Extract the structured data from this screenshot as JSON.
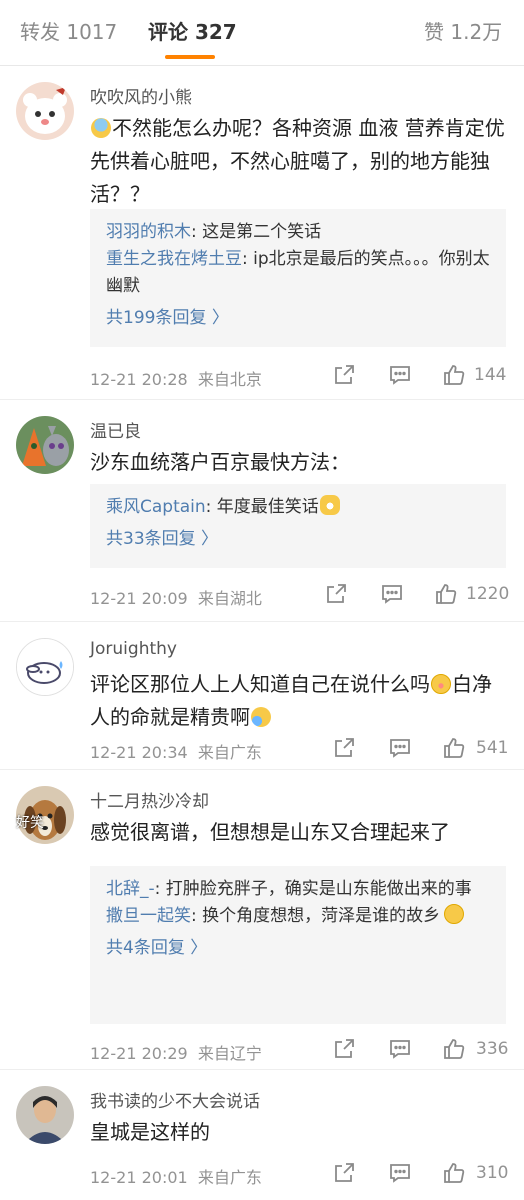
{
  "tabs": {
    "repost": "转发 1017",
    "comments": "评论 327",
    "likes": "赞 1.2万"
  },
  "comments": [
    {
      "author": "吹吹风的小熊",
      "text": "不然能怎么办呢？各种资源 血液 营养肯定优先供着心脏吧，不然心脏噶了，别的地方能独活？？",
      "emoji": "fear-emoji",
      "replies": [
        {
          "user": "羽羽的积木",
          "text": ": 这是第二个笑话"
        },
        {
          "user": "重生之我在烤土豆",
          "text": ": ip北京是最后的笑点。。。你别太幽默"
        }
      ],
      "more": "共199条回复 〉",
      "time": "12-21 20:28",
      "location": "来自北京",
      "likes": "144"
    },
    {
      "author": "温已良",
      "text": "沙东血统落户百京最快方法：",
      "replies": [
        {
          "user": "乘风Captain",
          "text": ": 年度最佳笑话"
        }
      ],
      "more": "共33条回复 〉",
      "time": "12-21 20:09",
      "location": "来自湖北",
      "likes": "1220"
    },
    {
      "author": "Joruighthy",
      "text_a": "评论区那位人上人知道自己在说什么吗",
      "text_b": "白净人的命就是精贵啊",
      "time": "12-21 20:34",
      "location": "来自广东",
      "likes": "541"
    },
    {
      "author": "十二月热沙冷却",
      "avatar_text": "好笑",
      "text": "感觉很离谱，但想想是山东又合理起来了",
      "replies": [
        {
          "user": "北辞_-",
          "text": ": 打肿脸充胖子，确实是山东能做出来的事"
        },
        {
          "user": "撒旦一起笑",
          "text": ": 换个角度想想，菏泽是谁的故乡"
        }
      ],
      "more": "共4条回复 〉",
      "time": "12-21 20:29",
      "location": "来自辽宁",
      "likes": "336"
    },
    {
      "author": "我书读的少不大会说话",
      "text": "皇城是这样的",
      "time": "12-21 20:01",
      "location": "来自广东",
      "likes": "310"
    }
  ],
  "icons": {
    "repost": "share-icon",
    "comment": "comment-icon",
    "like": "thumbs-up-icon"
  },
  "colors": {
    "accent": "#ff8200",
    "link": "#507daf",
    "meta": "#939393"
  }
}
